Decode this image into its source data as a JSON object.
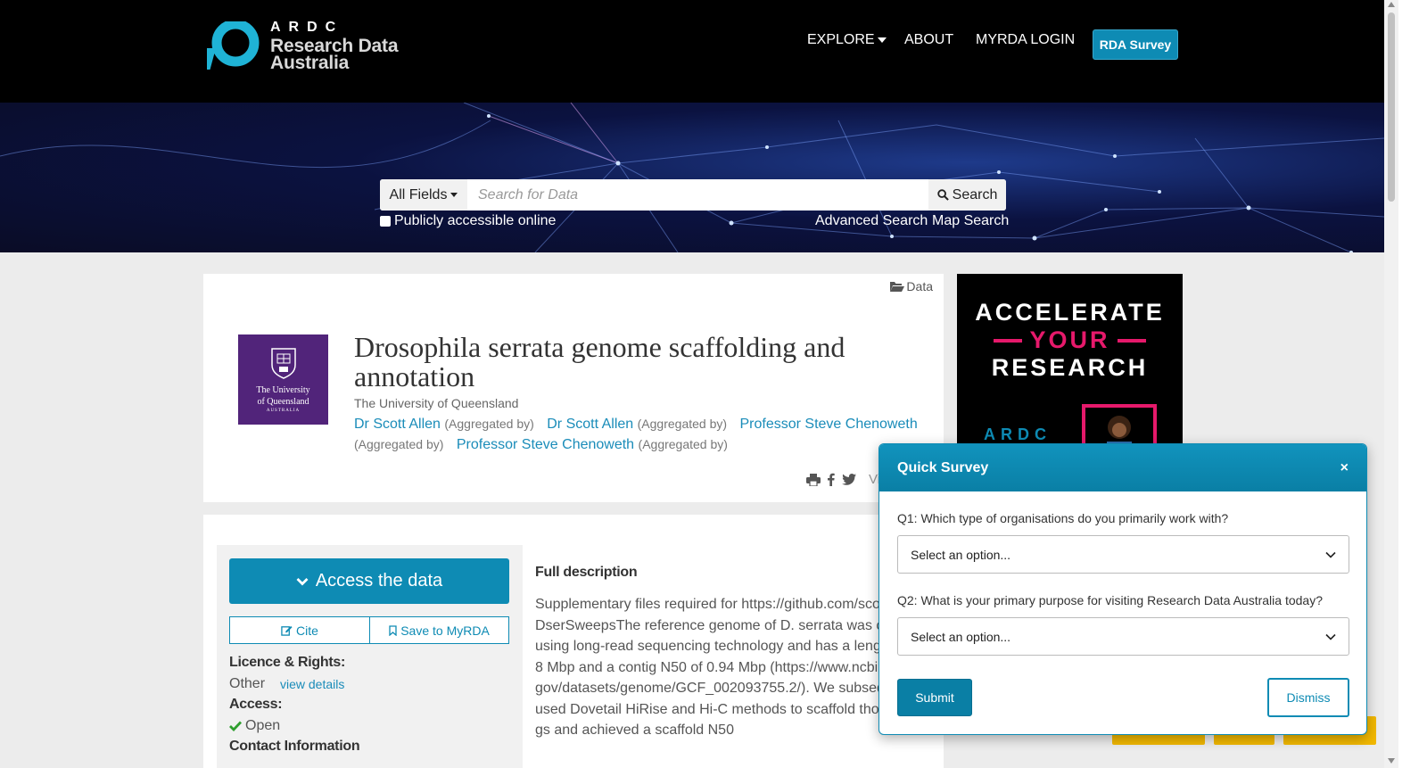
{
  "header": {
    "logo_mark": "ARDC",
    "logo_line1": "Research Data",
    "logo_line2": "Australia",
    "nav": {
      "explore": "EXPLORE",
      "about": "ABOUT",
      "login": "MYRDA LOGIN",
      "survey_button": "RDA Survey"
    }
  },
  "search": {
    "field_select": "All Fields",
    "placeholder": "Search for Data",
    "button": "Search",
    "public_checkbox_label": "Publicly accessible online",
    "advanced_link": "Advanced Search",
    "map_link": "Map Search"
  },
  "record": {
    "type_label": "Data",
    "logo_text_line1": "The University",
    "logo_text_line2": "of Queensland",
    "logo_text_line3": "AUSTRALIA",
    "title": "Drosophila serrata genome scaffolding and annotation",
    "publisher": "The University of Queensland",
    "contributors": [
      {
        "name": "Dr Scott Allen",
        "role": "(Aggregated by)"
      },
      {
        "name": "Dr Scott Allen",
        "role": "(Aggregated by)"
      },
      {
        "name": "Professor Steve Chenoweth",
        "role": "(Aggregated by)"
      },
      {
        "name": "Professor Steve Chenoweth",
        "role": "(Aggregated by)"
      }
    ],
    "share_partial": "Vi"
  },
  "sidebar": {
    "access_button": "Access the data",
    "cite_button": "Cite",
    "save_button": "Save to MyRDA",
    "licence_label": "Licence & Rights:",
    "licence_value": "Other",
    "view_details": "view details",
    "access_label": "Access:",
    "access_value": "Open",
    "contact_label": "Contact Information"
  },
  "description": {
    "heading": "Full description",
    "text": "Supplementary files required for https://github.com/scottlallen/DserSweepsThe reference genome of D. serrata was created using long-read sequencing technology and has a length of 198 Mbp and a contig N50 of 0.94 Mbp (https://www.ncbi.nlm.nih.gov/datasets/genome/GCF_002093755.2/). We subsequently used Dovetail HiRise and Hi-C methods to scaffold those contigs and achieved a scaffold N50"
  },
  "ad": {
    "line1": "ACCELERATE",
    "line2": "YOUR",
    "line3": "RESEARCH",
    "brand": "ARDC"
  },
  "survey": {
    "title": "Quick Survey",
    "close": "×",
    "q1": "Q1: Which type of organisations do you primarily work with?",
    "q1_select": "Select an option...",
    "q2": "Q2: What is your primary purpose for visiting Research Data Australia today?",
    "q2_select": "Select an option...",
    "submit": "Submit",
    "dismiss": "Dismiss"
  },
  "colors": {
    "accent": "#0e8bb4",
    "link": "#1a8cb9",
    "uq_purple": "#51247a",
    "ad_pink": "#e6196b"
  }
}
